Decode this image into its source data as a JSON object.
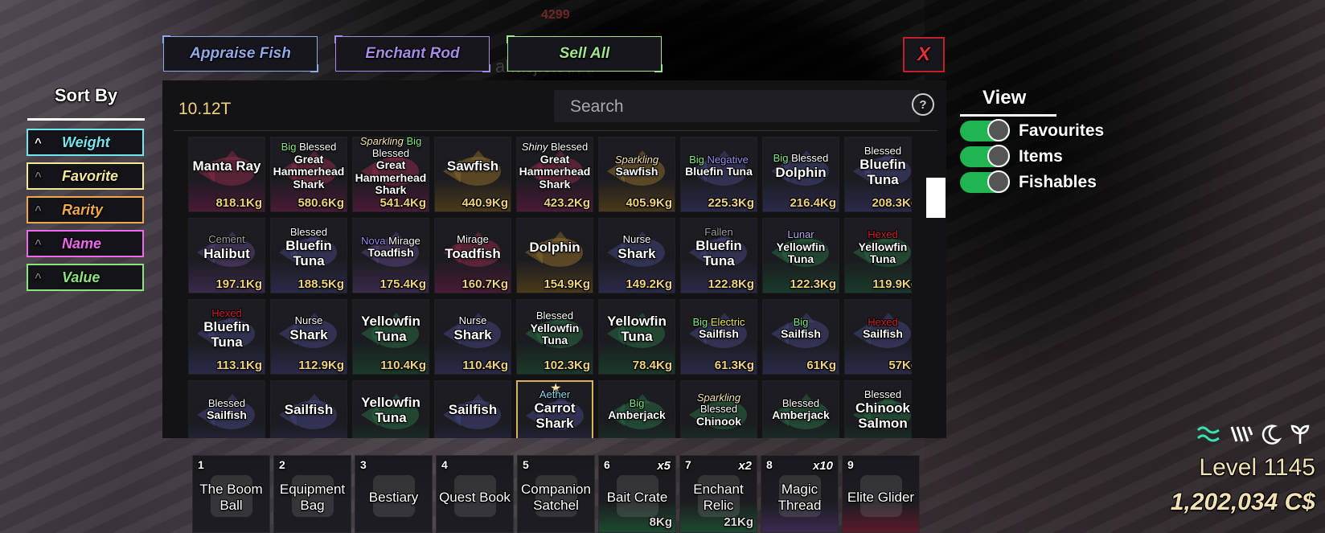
{
  "colors": {
    "accent_green": "#20b552",
    "gold": "#f0d27a",
    "close_red": "#e0303a"
  },
  "background": {
    "ghost_text": "ahasjfelsddd",
    "ghost_num": "4299"
  },
  "top_buttons": [
    {
      "label": "Appraise Fish",
      "color": "#8fa9e8"
    },
    {
      "label": "Enchant Rod",
      "color": "#a58ae6"
    },
    {
      "label": "Sell All",
      "color": "#9ee68a"
    }
  ],
  "close": {
    "label": "X"
  },
  "sort": {
    "title": "Sort By",
    "options": [
      {
        "label": "Weight",
        "color": "#6fe6f0",
        "active": true
      },
      {
        "label": "Favorite",
        "color": "#f2e79a",
        "active": false
      },
      {
        "label": "Rarity",
        "color": "#f0a84e",
        "active": false
      },
      {
        "label": "Name",
        "color": "#ee68ee",
        "active": false
      },
      {
        "label": "Value",
        "color": "#8ae67a",
        "active": false
      }
    ]
  },
  "inventory": {
    "balance": "10.12T",
    "search_placeholder": "Search",
    "help_icon": "?",
    "fish": [
      {
        "mods": [],
        "name": "Manta Ray",
        "weight": "818.1Kg",
        "tint": "#4a1a36",
        "fish_color": "#8a2a4a"
      },
      {
        "mods": [
          {
            "t": "Big",
            "c": "#7cf07c"
          },
          {
            "t": "Blessed",
            "c": "#ffffff"
          }
        ],
        "name": "Great Hammerhead Shark",
        "weight": "580.6Kg",
        "tint": "#4a1a36",
        "fish_color": "#8a2a4a",
        "small": true
      },
      {
        "mods": [
          {
            "t": "Sparkling",
            "c": "#f5e6a8",
            "i": true
          },
          {
            "t": "Big",
            "c": "#7cf07c"
          },
          {
            "t": "Blessed",
            "c": "#ffffff"
          }
        ],
        "name": "Great Hammerhead Shark",
        "weight": "541.4Kg",
        "tint": "#4a1a36",
        "fish_color": "#8a2a4a",
        "small": true
      },
      {
        "mods": [],
        "name": "Sawfish",
        "weight": "440.9Kg",
        "tint": "#4a3a1a",
        "fish_color": "#8a6a2a"
      },
      {
        "mods": [
          {
            "t": "Shiny",
            "c": "#ffffff",
            "i": true
          },
          {
            "t": "Blessed",
            "c": "#ffffff"
          }
        ],
        "name": "Great Hammerhead Shark",
        "weight": "423.2Kg",
        "tint": "#4a1a36",
        "fish_color": "#8a2a4a",
        "small": true
      },
      {
        "mods": [
          {
            "t": "Sparkling",
            "c": "#f5e6a8",
            "i": true
          }
        ],
        "name": "Sawfish",
        "weight": "405.9Kg",
        "tint": "#4a3a1a",
        "fish_color": "#8a6a2a",
        "small": true
      },
      {
        "mods": [
          {
            "t": "Big",
            "c": "#7cf07c"
          },
          {
            "t": "Negative",
            "c": "#9a8cf0"
          }
        ],
        "name": "Bluefin Tuna",
        "weight": "225.3Kg",
        "tint": "#2a2a4a",
        "fish_color": "#44447a",
        "small": true
      },
      {
        "mods": [
          {
            "t": "Big",
            "c": "#7cf07c"
          },
          {
            "t": "Blessed",
            "c": "#ffffff"
          }
        ],
        "name": "Dolphin",
        "weight": "216.4Kg",
        "tint": "#2a2a4a",
        "fish_color": "#44447a"
      },
      {
        "mods": [
          {
            "t": "Blessed",
            "c": "#ffffff"
          }
        ],
        "name": "Bluefin Tuna",
        "weight": "208.3Kg",
        "tint": "#2a2a4a",
        "fish_color": "#44447a"
      },
      {
        "mods": [
          {
            "t": "Cement",
            "c": "#a0a0a0"
          }
        ],
        "name": "Halibut",
        "weight": "197.1Kg",
        "tint": "#3a2a4a",
        "fish_color": "#5a447a"
      },
      {
        "mods": [
          {
            "t": "Blessed",
            "c": "#ffffff"
          }
        ],
        "name": "Bluefin Tuna",
        "weight": "188.5Kg",
        "tint": "#2a2a4a",
        "fish_color": "#44447a"
      },
      {
        "mods": [
          {
            "t": "Nova",
            "c": "#9a8cf0"
          },
          {
            "t": "Mirage",
            "c": "#ffffff"
          }
        ],
        "name": "Toadfish",
        "weight": "175.4Kg",
        "tint": "#3a2a4a",
        "fish_color": "#5a447a",
        "small": true
      },
      {
        "mods": [
          {
            "t": "Mirage",
            "c": "#ffffff"
          }
        ],
        "name": "Toadfish",
        "weight": "160.7Kg",
        "tint": "#4a1a36",
        "fish_color": "#8a2a4a"
      },
      {
        "mods": [],
        "name": "Dolphin",
        "weight": "154.9Kg",
        "tint": "#4a3a1a",
        "fish_color": "#8a6a2a"
      },
      {
        "mods": [
          {
            "t": "Nurse",
            "c": "#ffffff"
          }
        ],
        "name": "Shark",
        "weight": "149.2Kg",
        "tint": "#2a2a4a",
        "fish_color": "#44447a"
      },
      {
        "mods": [
          {
            "t": "Fallen",
            "c": "#a0a0a0"
          }
        ],
        "name": "Bluefin Tuna",
        "weight": "122.8Kg",
        "tint": "#2a2a4a",
        "fish_color": "#44447a"
      },
      {
        "mods": [
          {
            "t": "Lunar",
            "c": "#b8a8f0"
          }
        ],
        "name": "Yellowfin Tuna",
        "weight": "122.3Kg",
        "tint": "#1a3a2a",
        "fish_color": "#2a6a44",
        "small": true
      },
      {
        "mods": [
          {
            "t": "Hexed",
            "c": "#d02020"
          }
        ],
        "name": "Yellowfin Tuna",
        "weight": "119.9Kg",
        "tint": "#1a3a2a",
        "fish_color": "#2a6a44",
        "small": true
      },
      {
        "mods": [
          {
            "t": "Hexed",
            "c": "#d02020"
          }
        ],
        "name": "Bluefin Tuna",
        "weight": "113.1Kg",
        "tint": "#2a2a4a",
        "fish_color": "#44447a"
      },
      {
        "mods": [
          {
            "t": "Nurse",
            "c": "#ffffff"
          }
        ],
        "name": "Shark",
        "weight": "112.9Kg",
        "tint": "#2a2a4a",
        "fish_color": "#44447a"
      },
      {
        "mods": [],
        "name": "Yellowfin Tuna",
        "weight": "110.4Kg",
        "tint": "#1a3a2a",
        "fish_color": "#2a6a44"
      },
      {
        "mods": [
          {
            "t": "Nurse",
            "c": "#ffffff"
          }
        ],
        "name": "Shark",
        "weight": "110.4Kg",
        "tint": "#2a2a4a",
        "fish_color": "#44447a"
      },
      {
        "mods": [
          {
            "t": "Blessed",
            "c": "#ffffff"
          }
        ],
        "name": "Yellowfin Tuna",
        "weight": "102.3Kg",
        "tint": "#1a3a2a",
        "fish_color": "#2a6a44",
        "small": true
      },
      {
        "mods": [],
        "name": "Yellowfin Tuna",
        "weight": "78.4Kg",
        "tint": "#1a3a2a",
        "fish_color": "#2a6a44"
      },
      {
        "mods": [
          {
            "t": "Big",
            "c": "#7cf07c"
          },
          {
            "t": "Electric",
            "c": "#f0e84a"
          }
        ],
        "name": "Sailfish",
        "weight": "61.3Kg",
        "tint": "#2a2a4a",
        "fish_color": "#44447a",
        "small": true
      },
      {
        "mods": [
          {
            "t": "Big",
            "c": "#7cf07c"
          }
        ],
        "name": "Sailfish",
        "weight": "61Kg",
        "tint": "#2a2a4a",
        "fish_color": "#44447a",
        "small": true
      },
      {
        "mods": [
          {
            "t": "Hexed",
            "c": "#d02020"
          }
        ],
        "name": "Sailfish",
        "weight": "57Kg",
        "tint": "#2a2a4a",
        "fish_color": "#44447a",
        "small": true
      },
      {
        "mods": [
          {
            "t": "Blessed",
            "c": "#ffffff"
          }
        ],
        "name": "Sailfish",
        "weight": "",
        "tint": "#2a2a4a",
        "fish_color": "#44447a",
        "small": true
      },
      {
        "mods": [],
        "name": "Sailfish",
        "weight": "",
        "tint": "#2a2a4a",
        "fish_color": "#44447a"
      },
      {
        "mods": [],
        "name": "Yellowfin Tuna",
        "weight": "",
        "tint": "#1a3a2a",
        "fish_color": "#2a6a44"
      },
      {
        "mods": [],
        "name": "Sailfish",
        "weight": "",
        "tint": "#2a2a4a",
        "fish_color": "#44447a"
      },
      {
        "mods": [
          {
            "t": "Aether",
            "c": "#8ad8f0"
          }
        ],
        "name": "Carrot Shark",
        "weight": "",
        "tint": "#2a2a4a",
        "fish_color": "#44447a",
        "fav": true
      },
      {
        "mods": [
          {
            "t": "Big",
            "c": "#7cf07c"
          }
        ],
        "name": "Amberjack",
        "weight": "",
        "tint": "#1a3a2a",
        "fish_color": "#2a6a44",
        "small": true
      },
      {
        "mods": [
          {
            "t": "Sparkling",
            "c": "#f5e6a8",
            "i": true
          },
          {
            "t": "Blessed",
            "c": "#ffffff"
          }
        ],
        "name": "Chinook",
        "weight": "",
        "tint": "#1a3a2a",
        "fish_color": "#2a6a44",
        "small": true
      },
      {
        "mods": [
          {
            "t": "Blessed",
            "c": "#ffffff"
          }
        ],
        "name": "Amberjack",
        "weight": "",
        "tint": "#1a3a2a",
        "fish_color": "#2a6a44",
        "small": true
      },
      {
        "mods": [
          {
            "t": "Blessed",
            "c": "#ffffff"
          }
        ],
        "name": "Chinook Salmon",
        "weight": "",
        "tint": "#1a3a2a",
        "fish_color": "#2a6a44"
      }
    ]
  },
  "view": {
    "title": "View",
    "toggles": [
      {
        "label": "Favourites",
        "on": true
      },
      {
        "label": "Items",
        "on": true
      },
      {
        "label": "Fishables",
        "on": true
      }
    ]
  },
  "hotbar": [
    {
      "num": "1",
      "label": "The Boom Ball",
      "qty": "",
      "weight": "",
      "tint": "#1c1c21"
    },
    {
      "num": "2",
      "label": "Equipment Bag",
      "qty": "",
      "weight": "",
      "tint": "#1c1c21"
    },
    {
      "num": "3",
      "label": "Bestiary",
      "qty": "",
      "weight": "",
      "tint": "#1c1c21"
    },
    {
      "num": "4",
      "label": "Quest Book",
      "qty": "",
      "weight": "",
      "tint": "#1c1c21"
    },
    {
      "num": "5",
      "label": "Companion Satchel",
      "qty": "",
      "weight": "",
      "tint": "#1c1c21"
    },
    {
      "num": "6",
      "label": "Bait Crate",
      "qty": "x5",
      "weight": "8Kg",
      "tint": "#1d4a30"
    },
    {
      "num": "7",
      "label": "Enchant Relic",
      "qty": "x2",
      "weight": "21Kg",
      "tint": "#1d4a30"
    },
    {
      "num": "8",
      "label": "Magic Thread",
      "qty": "x10",
      "weight": "",
      "tint": "#3a2a50"
    },
    {
      "num": "9",
      "label": "Elite Glider",
      "qty": "",
      "weight": "",
      "tint": "#5a1a2a"
    }
  ],
  "status_icons": [
    "waves-icon",
    "rain-icon",
    "moon-icon",
    "sprout-icon"
  ],
  "player": {
    "level": "Level 1145",
    "currency": "1,202,034 C$"
  }
}
